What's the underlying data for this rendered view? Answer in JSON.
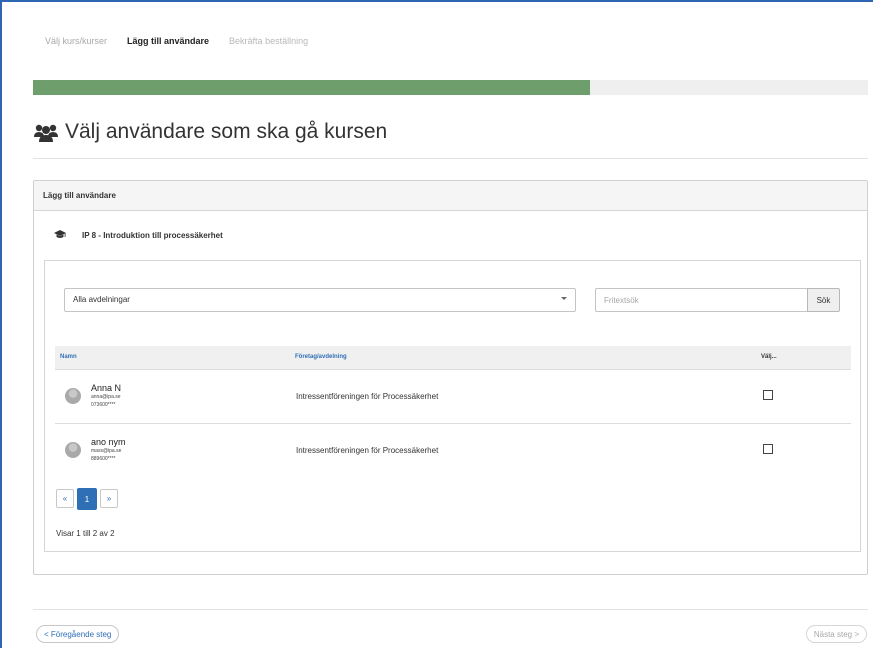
{
  "wizard": {
    "steps": [
      {
        "label": "Välj kurs/kurser",
        "state": "completed"
      },
      {
        "label": "Lägg till användare",
        "state": "current"
      },
      {
        "label": "Bekräfta beställning",
        "state": "upcoming"
      }
    ],
    "progress_fraction": 0.667
  },
  "page": {
    "title": "Välj användare som ska gå kursen",
    "title_icon": "users-icon"
  },
  "panel": {
    "heading": "Lägg till användare",
    "course_icon": "graduation-cap-icon",
    "course_name": "IP 8 - Introduktion till processäkerhet"
  },
  "filters": {
    "department_selected": "Alla avdelningar",
    "search_placeholder": "Fritextsök",
    "search_button": "Sök"
  },
  "table": {
    "headers": {
      "name": "Namn",
      "company": "Företag/avdelning",
      "select": "Välj..."
    },
    "rows": [
      {
        "name": "Anna N",
        "email": "anna@ipa.se",
        "phone": "073600****",
        "company": "Intressentföreningen för Processäkerhet",
        "checked": false
      },
      {
        "name": "ano nym",
        "email": "mass@ipa.se",
        "phone": "889600****",
        "company": "Intressentföreningen för Processäkerhet",
        "checked": false
      }
    ]
  },
  "pagination": {
    "prev": "«",
    "current": "1",
    "next": "»",
    "summary": "Visar 1 till 2 av 2"
  },
  "navigation": {
    "prev_label": "< Föregående steg",
    "next_label": "Nästa steg >"
  },
  "colors": {
    "progress": "#6e9e6c",
    "accent": "#2f6fb6"
  }
}
